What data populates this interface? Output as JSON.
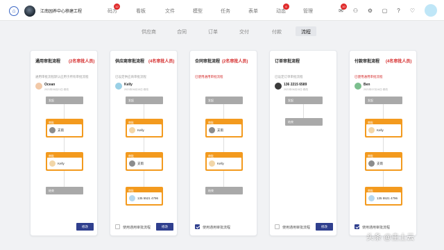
{
  "header": {
    "project": "江南园养中心移建工程",
    "nav": [
      {
        "label": "码方",
        "badge": "12"
      },
      {
        "label": "看板",
        "badge": ""
      },
      {
        "label": "文件",
        "badge": ""
      },
      {
        "label": "模型",
        "badge": ""
      },
      {
        "label": "任务",
        "badge": ""
      },
      {
        "label": "表单",
        "badge": ""
      },
      {
        "label": "动态",
        "badge": "6"
      },
      {
        "label": "管理",
        "badge": ""
      }
    ],
    "mail_badge": "10"
  },
  "tabs": [
    "供应商",
    "合同",
    "订单",
    "交付",
    "付款",
    "流程"
  ],
  "active_tab": "流程",
  "cards": [
    {
      "title": "通用审批流程",
      "required": "(2名审批人员)",
      "desc": "通用审批流程默认应用于所有审批流程",
      "desc_red": false,
      "owner": {
        "name": "Ocean",
        "date": "2021年06月21日 修改"
      },
      "start": "发起",
      "approvers": [
        {
          "label": "审批",
          "name": "支雨"
        },
        {
          "label": "审批",
          "name": "Kelly"
        }
      ],
      "end": "结束",
      "checkbox": null,
      "button": "修改"
    },
    {
      "title": "供应商审批流程",
      "required": "(4名审批人员)",
      "desc": "已设定供应商审批流程",
      "desc_red": false,
      "owner": {
        "name": "Kelly",
        "date": "2021年06月15日 修改"
      },
      "start": "发起",
      "approvers": [
        {
          "label": "审批",
          "name": "Kelly"
        },
        {
          "label": "审批",
          "name": "支雨"
        },
        {
          "label": "审批",
          "name": "135 5521 4796"
        }
      ],
      "end": "",
      "checkbox": {
        "label": "使用通用审批流程",
        "checked": false
      },
      "button": "修改"
    },
    {
      "title": "合同审批流程",
      "required": "(2名审批人员)",
      "desc": "已使用通用审批流程",
      "desc_red": true,
      "owner": null,
      "start": "发起",
      "approvers": [
        {
          "label": "审批",
          "name": "支雨"
        },
        {
          "label": "审批",
          "name": "Kelly"
        }
      ],
      "end": "结束",
      "checkbox": {
        "label": "使用通用审批流程",
        "checked": true
      },
      "button": ""
    },
    {
      "title": "订单审批流程",
      "required": "",
      "desc": "已设定订单审批流程",
      "desc_red": false,
      "owner": {
        "name": "136 2215 6589",
        "date": "2021年06月15日 修改"
      },
      "start": "发起",
      "approvers": [],
      "end": "结束",
      "checkbox": {
        "label": "使用通用审批流程",
        "checked": false
      },
      "button": "修改"
    },
    {
      "title": "付款审批流程",
      "required": "(4名审批人员)",
      "desc": "已使用通用审批流程",
      "desc_red": true,
      "owner": {
        "name": "Ben",
        "date": "2021年07月16日 修改"
      },
      "start": "发起",
      "approvers": [
        {
          "label": "审批",
          "name": "Kelly"
        },
        {
          "label": "审批",
          "name": "支雨"
        },
        {
          "label": "审批",
          "name": "135 5521 4796"
        }
      ],
      "end": "",
      "checkbox": {
        "label": "使用通用审批流程",
        "checked": true
      },
      "button": ""
    }
  ],
  "watermark": "头条 @圭土云"
}
